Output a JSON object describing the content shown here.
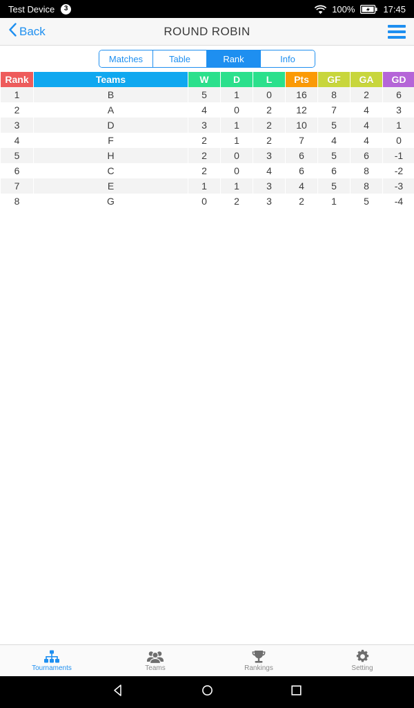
{
  "status_bar": {
    "device_name": "Test Device",
    "notification_count": "3",
    "wifi_icon": "wifi-icon",
    "battery_percent": "100%",
    "battery_icon": "battery-charging-icon",
    "time": "17:45"
  },
  "navbar": {
    "back_label": "Back",
    "back_icon": "chevron-left-icon",
    "title": "ROUND ROBIN",
    "menu_icon": "hamburger-menu-icon"
  },
  "segmented": {
    "items": [
      {
        "label": "Matches",
        "active": false
      },
      {
        "label": "Table",
        "active": false
      },
      {
        "label": "Rank",
        "active": true
      },
      {
        "label": "Info",
        "active": false
      }
    ]
  },
  "table": {
    "columns": [
      {
        "key": "rank",
        "label": "Rank",
        "color": "#EE5B5B"
      },
      {
        "key": "teams",
        "label": "Teams",
        "color": "#0FA8F0"
      },
      {
        "key": "w",
        "label": "W",
        "color": "#2BE08C"
      },
      {
        "key": "d",
        "label": "D",
        "color": "#2BE08C"
      },
      {
        "key": "l",
        "label": "L",
        "color": "#2BE08C"
      },
      {
        "key": "pts",
        "label": "Pts",
        "color": "#FB9A06"
      },
      {
        "key": "gf",
        "label": "GF",
        "color": "#C8D63C"
      },
      {
        "key": "ga",
        "label": "GA",
        "color": "#C8D63C"
      },
      {
        "key": "gd",
        "label": "GD",
        "color": "#B565D8"
      }
    ],
    "rows": [
      {
        "rank": "1",
        "teams": "B",
        "w": "5",
        "d": "1",
        "l": "0",
        "pts": "16",
        "gf": "8",
        "ga": "2",
        "gd": "6"
      },
      {
        "rank": "2",
        "teams": "A",
        "w": "4",
        "d": "0",
        "l": "2",
        "pts": "12",
        "gf": "7",
        "ga": "4",
        "gd": "3"
      },
      {
        "rank": "3",
        "teams": "D",
        "w": "3",
        "d": "1",
        "l": "2",
        "pts": "10",
        "gf": "5",
        "ga": "4",
        "gd": "1"
      },
      {
        "rank": "4",
        "teams": "F",
        "w": "2",
        "d": "1",
        "l": "2",
        "pts": "7",
        "gf": "4",
        "ga": "4",
        "gd": "0"
      },
      {
        "rank": "5",
        "teams": "H",
        "w": "2",
        "d": "0",
        "l": "3",
        "pts": "6",
        "gf": "5",
        "ga": "6",
        "gd": "-1"
      },
      {
        "rank": "6",
        "teams": "C",
        "w": "2",
        "d": "0",
        "l": "4",
        "pts": "6",
        "gf": "6",
        "ga": "8",
        "gd": "-2"
      },
      {
        "rank": "7",
        "teams": "E",
        "w": "1",
        "d": "1",
        "l": "3",
        "pts": "4",
        "gf": "5",
        "ga": "8",
        "gd": "-3"
      },
      {
        "rank": "8",
        "teams": "G",
        "w": "0",
        "d": "2",
        "l": "3",
        "pts": "2",
        "gf": "1",
        "ga": "5",
        "gd": "-4"
      }
    ]
  },
  "tabbar": {
    "items": [
      {
        "label": "Tournaments",
        "icon": "hierarchy-icon",
        "active": true
      },
      {
        "label": "Teams",
        "icon": "people-icon",
        "active": false
      },
      {
        "label": "Rankings",
        "icon": "trophy-icon",
        "active": false
      },
      {
        "label": "Setting",
        "icon": "gear-icon",
        "active": false
      }
    ]
  },
  "android_nav": {
    "back_icon": "android-back-icon",
    "home_icon": "android-home-icon",
    "recents_icon": "android-recents-icon"
  },
  "colors": {
    "accent": "#1E8FF0",
    "status_bar_bg": "#000000",
    "navbar_bg": "#F7F7F7",
    "row_shade": "#F3F3F3"
  }
}
